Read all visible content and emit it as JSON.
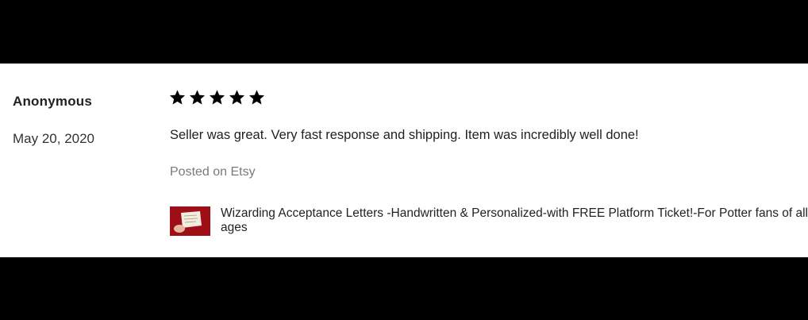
{
  "review": {
    "reviewer_name": "Anonymous",
    "date": "May 20, 2020",
    "rating": 5,
    "rating_max": 5,
    "text": "Seller was great. Very fast response and shipping. Item was incredibly well done!",
    "source": "Posted on Etsy",
    "listing": {
      "title": "Wizarding Acceptance Letters -Handwritten & Personalized-with FREE Platform Ticket!-For Potter fans of all ages",
      "thumbnail_icon": "listing-thumbnail-image"
    }
  },
  "colors": {
    "background_band": "#000000",
    "card": "#ffffff",
    "star": "#000000",
    "source_text": "#7a7a7a"
  }
}
